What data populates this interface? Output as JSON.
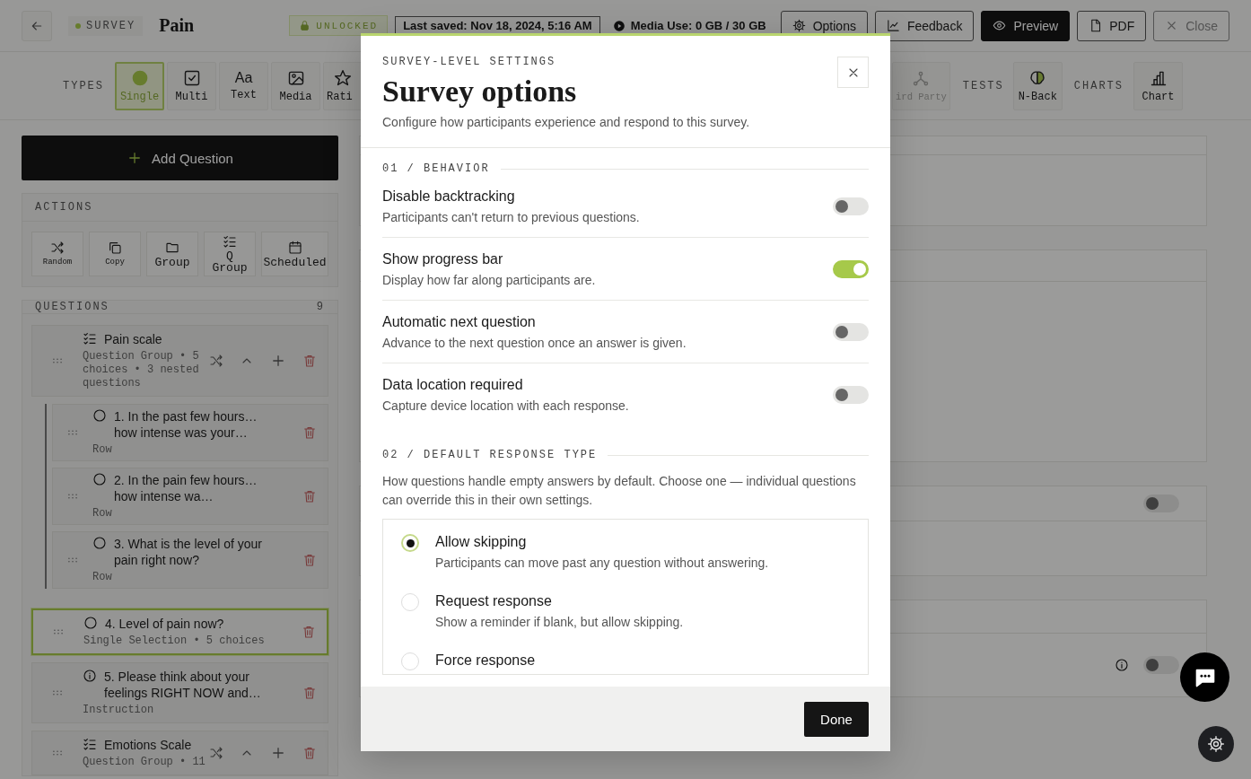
{
  "top_bar": {
    "chip": "SURVEY",
    "title": "Pain",
    "lock_badge": "UNLOCKED",
    "last_saved": "Last saved: Nov 18, 2024, 5:16 AM",
    "media_use": "Media Use: 0 GB / 30 GB",
    "buttons": [
      {
        "label": "Options",
        "kind": "options"
      },
      {
        "label": "Feedback",
        "kind": "feedback"
      },
      {
        "label": "Preview",
        "kind": "preview"
      },
      {
        "label": "PDF",
        "kind": "pdf"
      },
      {
        "label": "Close",
        "kind": "close"
      }
    ]
  },
  "toolbar": {
    "types_label": "TYPES",
    "types": [
      {
        "label": "Single",
        "kind": "dot",
        "selected": true
      },
      {
        "label": "Multi",
        "kind": "checkbox",
        "selected": false
      },
      {
        "label": "Text",
        "kind": "glyph",
        "glyph": "Aa",
        "selected": false
      },
      {
        "label": "Media",
        "kind": "image",
        "selected": false
      },
      {
        "label": "Rati",
        "kind": "star",
        "selected": false,
        "cut": true
      }
    ],
    "more": [
      {
        "label": "ird Party",
        "disabled": true
      }
    ],
    "tests_label": "TESTS",
    "tests": [
      {
        "label": "N-Back",
        "kind": "brain"
      }
    ],
    "charts_label": "CHARTS",
    "charts": [
      {
        "label": "Chart",
        "kind": "barchart"
      }
    ]
  },
  "sidebar": {
    "add_button": "Add Question",
    "actions_title": "ACTIONS",
    "actions": [
      {
        "label": "Random",
        "kind": "shuffle",
        "small": true
      },
      {
        "label": "Copy",
        "kind": "copy",
        "small": true
      },
      {
        "label": "Group",
        "kind": "folder",
        "small": false
      },
      {
        "label": "Q Group",
        "kind": "checklist",
        "small": false
      },
      {
        "label": "Scheduled",
        "kind": "calendar",
        "small": false
      }
    ],
    "questions_title": "QUESTIONS",
    "questions_count": "9",
    "questions": [
      {
        "kind": "group",
        "title": "Pain scale",
        "subtitle": "Question Group • 5 choices • 3 nested questions",
        "selected": false,
        "children": [
          {
            "kind": "single",
            "title": "1. In the past few hours… how intense was your…",
            "subtitle": "Row",
            "selected": false
          },
          {
            "kind": "single",
            "title": "2. In the pain few hours… how intense wa…",
            "subtitle": "Row",
            "selected": false
          },
          {
            "kind": "single",
            "title": "3. What is the level of your pain right now?",
            "subtitle": "Row",
            "selected": false
          }
        ]
      },
      {
        "kind": "single",
        "title": "4. Level of pain now?",
        "subtitle": "Single Selection • 5 choices",
        "selected": true
      },
      {
        "kind": "instruction",
        "title": "5. Please think about your feelings RIGHT NOW and…",
        "subtitle": "Instruction",
        "selected": false
      },
      {
        "kind": "group",
        "title": "Emotions Scale",
        "subtitle": "Question Group • 11",
        "selected": false
      }
    ]
  },
  "main": {
    "cards": [
      {
        "kind": "plain"
      },
      {
        "kind": "tall"
      },
      {
        "kind": "header_toggle",
        "on": false
      },
      {
        "kind": "info_toggle",
        "on": false
      }
    ]
  },
  "modal": {
    "eyebrow": "SURVEY-LEVEL SETTINGS",
    "title": "Survey options",
    "subtitle": "Configure how participants experience and respond to this survey.",
    "sections": [
      {
        "kind": "toggles",
        "heading": "01 / BEHAVIOR",
        "items": [
          {
            "title": "Disable backtracking",
            "description": "Participants can't return to previous questions.",
            "on": false
          },
          {
            "title": "Show progress bar",
            "description": "Display how far along participants are.",
            "on": true
          },
          {
            "title": "Automatic next question",
            "description": "Advance to the next question once an answer is given.",
            "on": false
          },
          {
            "title": "Data location required",
            "description": "Capture device location with each response.",
            "on": false
          }
        ]
      },
      {
        "kind": "radios",
        "heading": "02 / DEFAULT RESPONSE TYPE",
        "intro": "How questions handle empty answers by default. Choose one — individual questions can override this in their own settings.",
        "options": [
          {
            "title": "Allow skipping",
            "description": "Participants can move past any question without answering.",
            "selected": true
          },
          {
            "title": "Request response",
            "description": "Show a reminder if blank, but allow skipping.",
            "selected": false
          },
          {
            "title": "Force response",
            "selected": false
          }
        ]
      }
    ],
    "done": "Done"
  }
}
